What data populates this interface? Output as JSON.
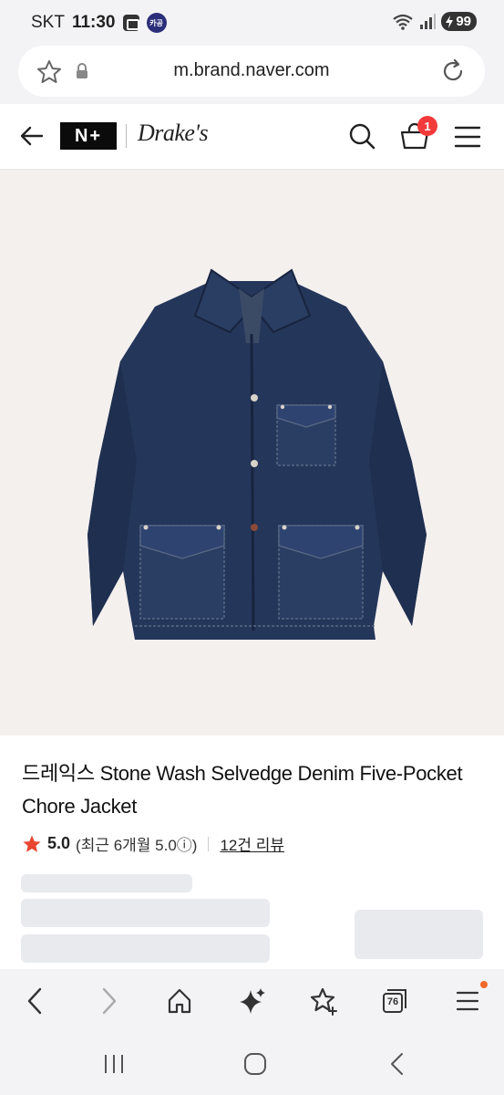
{
  "status_bar": {
    "carrier": "SKT",
    "time": "11:30",
    "notification_app_label": "카공",
    "battery": "99"
  },
  "browser": {
    "url": "m.brand.naver.com",
    "tab_count": "76"
  },
  "header": {
    "logo_text": "N+",
    "brand_name": "Drake's",
    "cart_count": "1"
  },
  "product": {
    "title": "드레익스 Stone Wash Selvedge Denim Five-Pocket Chore Jacket",
    "rating": "5.0",
    "recent_rating": "(최근 6개월 5.0ⓘ)",
    "review_count": "12건 리뷰"
  },
  "icons": {
    "status": [
      "message-icon",
      "wifi-icon",
      "signal-icon",
      "battery-icon"
    ],
    "url_bar": [
      "bookmark-star-icon",
      "lock-icon",
      "reload-icon"
    ],
    "header": [
      "back-arrow-icon",
      "search-icon",
      "cart-icon",
      "hamburger-menu-icon"
    ],
    "browser_bottom": [
      "back-icon",
      "forward-icon",
      "home-icon",
      "sparkle-icon",
      "favorites-icon",
      "tabs-icon",
      "menu-icon"
    ],
    "system_nav": [
      "recent-apps-icon",
      "home-circle-icon",
      "system-back-icon"
    ]
  },
  "colors": {
    "accent_red": "#f33a3a",
    "star_red": "#e8462f",
    "hero_background": "#f4f0ee",
    "denim": "#24365a"
  }
}
